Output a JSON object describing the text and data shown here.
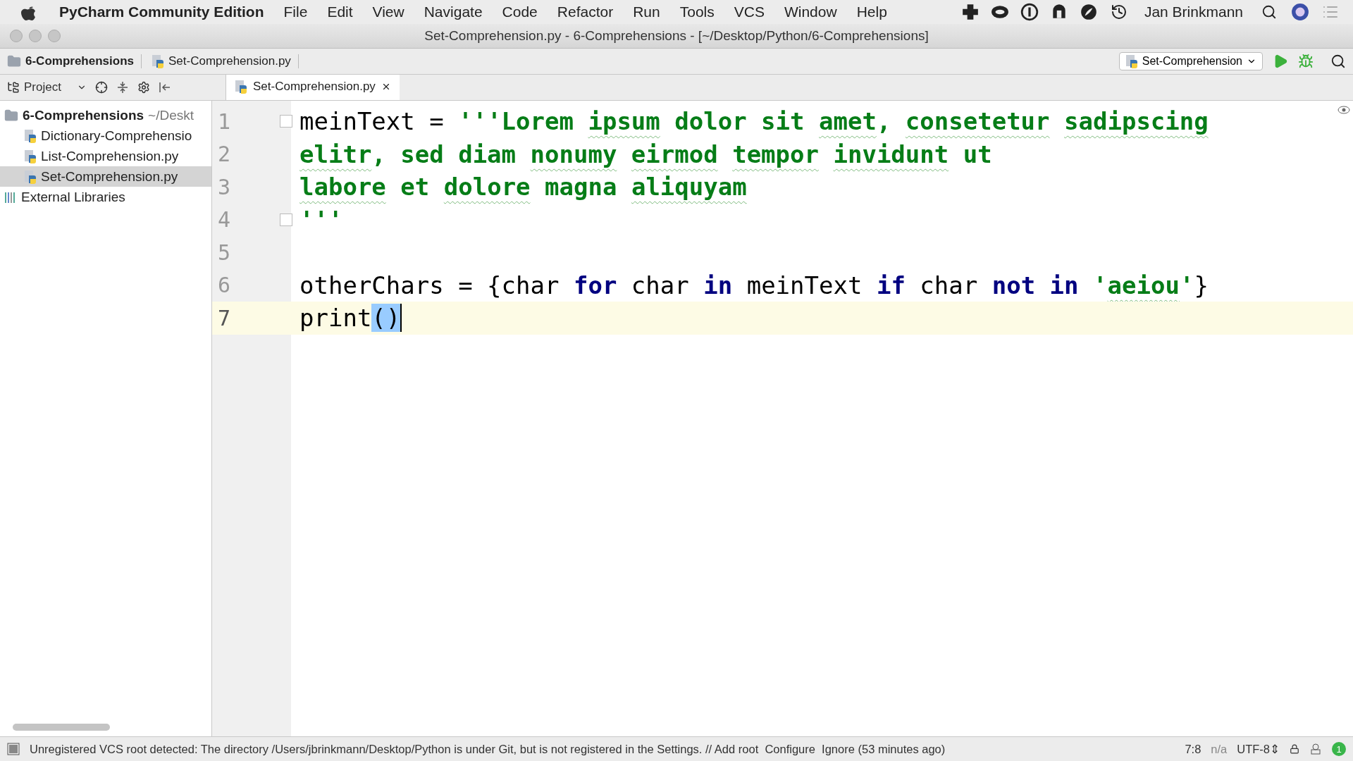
{
  "menu_bar": {
    "app_name": "PyCharm Community Edition",
    "items": [
      "File",
      "Edit",
      "View",
      "Navigate",
      "Code",
      "Refactor",
      "Run",
      "Tools",
      "VCS",
      "Window",
      "Help"
    ],
    "user": "Jan Brinkmann"
  },
  "window": {
    "title": "Set-Comprehension.py - 6-Comprehensions - [~/Desktop/Python/6-Comprehensions]"
  },
  "breadcrumbs": [
    {
      "label": "6-Comprehensions",
      "kind": "folder"
    },
    {
      "label": "Set-Comprehension.py",
      "kind": "file"
    }
  ],
  "run_config": "Set-Comprehension",
  "tool_window": {
    "label": "Project"
  },
  "editor_tabs": [
    {
      "label": "Set-Comprehension.py",
      "selected": true
    }
  ],
  "project_tree": [
    {
      "name": "6-Comprehensions",
      "hint": "~/Deskt",
      "kind": "folder",
      "selected": false,
      "children": [
        {
          "name": "Dictionary-Comprehensio",
          "kind": "file",
          "selected": false
        },
        {
          "name": "List-Comprehension.py",
          "kind": "file",
          "selected": false
        },
        {
          "name": "Set-Comprehension.py",
          "kind": "file",
          "selected": true
        }
      ]
    },
    {
      "name": "External Libraries",
      "kind": "library",
      "selected": false
    }
  ],
  "editor": {
    "lines": [
      {
        "number": "1",
        "current": false,
        "fold": true,
        "tokens": [
          {
            "text": "meinText = ",
            "kind": "plain"
          },
          {
            "text": "'''Lorem ",
            "kind": "string"
          },
          {
            "text": "ipsum",
            "kind": "string",
            "typo": true
          },
          {
            "text": " dolor sit ",
            "kind": "string"
          },
          {
            "text": "amet",
            "kind": "string",
            "typo": true
          },
          {
            "text": ", ",
            "kind": "string"
          },
          {
            "text": "consetetur ",
            "kind": "string",
            "typo": true
          },
          {
            "text": "sadipscing",
            "kind": "string",
            "typo": true
          }
        ]
      },
      {
        "number": "2",
        "current": false,
        "fold": false,
        "tokens": [
          {
            "text": "elitr",
            "kind": "string",
            "typo": true
          },
          {
            "text": ", sed diam ",
            "kind": "string"
          },
          {
            "text": "nonumy ",
            "kind": "string",
            "typo": true
          },
          {
            "text": "eirmod ",
            "kind": "string",
            "typo": true
          },
          {
            "text": "tempor ",
            "kind": "string",
            "typo": true
          },
          {
            "text": "invidunt",
            "kind": "string",
            "typo": true
          },
          {
            "text": " ut",
            "kind": "string"
          }
        ]
      },
      {
        "number": "3",
        "current": false,
        "fold": false,
        "tokens": [
          {
            "text": "labore",
            "kind": "string",
            "typo": true
          },
          {
            "text": " et ",
            "kind": "string"
          },
          {
            "text": "dolore",
            "kind": "string",
            "typo": true
          },
          {
            "text": " magna ",
            "kind": "string"
          },
          {
            "text": "aliquyam",
            "kind": "string",
            "typo": true
          }
        ]
      },
      {
        "number": "4",
        "current": false,
        "fold": true,
        "tokens": [
          {
            "text": "'''",
            "kind": "string"
          }
        ]
      },
      {
        "number": "5",
        "current": false,
        "fold": false
      },
      {
        "number": "6",
        "current": false,
        "fold": false,
        "tokens": [
          {
            "text": "otherChars = {char ",
            "kind": "plain"
          },
          {
            "text": "for",
            "kind": "keyword"
          },
          {
            "text": " char ",
            "kind": "plain"
          },
          {
            "text": "in",
            "kind": "keyword"
          },
          {
            "text": " meinText ",
            "kind": "plain"
          },
          {
            "text": "if",
            "kind": "keyword"
          },
          {
            "text": " char ",
            "kind": "plain"
          },
          {
            "text": "not in",
            "kind": "keyword"
          },
          {
            "text": " '",
            "kind": "string"
          },
          {
            "text": "aeiou",
            "kind": "string",
            "typo": true
          },
          {
            "text": "'",
            "kind": "string"
          },
          {
            "text": "}",
            "kind": "plain"
          }
        ]
      },
      {
        "number": "7",
        "current": true,
        "fold": false,
        "tokens": [
          {
            "text": "print",
            "kind": "plain"
          },
          {
            "text": "()",
            "kind": "brace-match",
            "caret": true
          }
        ]
      }
    ]
  },
  "status_bar": {
    "message": "Unregistered VCS root detected: The directory /Users/jbrinkmann/Desktop/Python is under Git, but is not registered in the Settings. // Add root  Configure  Ignore (53 minutes ago)",
    "position": "7:8",
    "lock": "n/a",
    "encoding": "UTF-8⇕",
    "badge": "1"
  }
}
